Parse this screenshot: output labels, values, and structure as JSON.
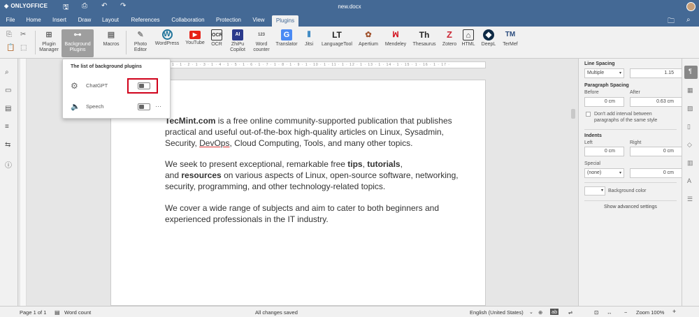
{
  "app": {
    "logo_text": "ONLYOFFICE",
    "doc_name": "new.docx"
  },
  "tabs": [
    "File",
    "Home",
    "Insert",
    "Draw",
    "Layout",
    "References",
    "Collaboration",
    "Protection",
    "View",
    "Plugins"
  ],
  "active_tab": "Plugins",
  "toolbar": {
    "plugin_manager": "Plugin Manager",
    "background_plugins": "Background Plugins",
    "macros": "Macros",
    "photo_editor": "Photo Editor",
    "wordpress": "WordPress",
    "youtube": "YouTube",
    "ocr": "OCR",
    "zhipu": "ZhiPu Copilot",
    "word_counter": "Word counter",
    "translator": "Translator",
    "jitsi": "Jitsi",
    "languagetool": "LanguageTool",
    "apertium": "Apertium",
    "mendeley": "Mendeley",
    "thesaurus": "Thesaurus",
    "zotero": "Zotero",
    "html": "HTML",
    "deepl": "DeepL",
    "termef": "TerMef"
  },
  "popup": {
    "title": "The list of background plugins",
    "items": [
      {
        "name": "ChatGPT",
        "enabled": false
      },
      {
        "name": "Speech",
        "enabled": false,
        "more": "···"
      }
    ]
  },
  "ruler_text": "· 1 · 1 · 2 · 1 · 3 · 1 · 4 · 1 · 5 · 1 · 6 · 1 · 7 · 1 · 8 · 1 · 9 · 1 · 10 · 1 · 11 · 1 · 12 · 1 · 13 · 1 · 14 · 1 · 15 · 1 · 16 · 1 · 17 ·",
  "document": {
    "p1": {
      "brand": "TecMint.com",
      "t1": " is a free online community-supported publication that publishes practical and useful out-of-the-box high-quality articles on Linux, Sysadmin, Security, ",
      "devops": "DevOps",
      "t2": ", Cloud Computing, Tools, and many other topics."
    },
    "p2": {
      "t1": "We seek to present exceptional, remarkable free ",
      "b1": "tips",
      "t2": ", ",
      "b2": "tutorials",
      "t3": ",",
      "t4": "and ",
      "b3": "resources",
      "t5": " on various aspects of Linux, open-source software, networking, security, programming, and other technology-related topics."
    },
    "p3": "We cover a wide range of subjects and aim to cater to both beginners and experienced professionals in the IT industry."
  },
  "right_panel": {
    "line_spacing": "Line Spacing",
    "line_spacing_mode": "Multiple",
    "line_spacing_value": "1.15",
    "paragraph_spacing": "Paragraph Spacing",
    "before_label": "Before",
    "after_label": "After",
    "before_value": "0 cm",
    "after_value": "0.63 cm",
    "dont_add": "Don't add interval between paragraphs of the same style",
    "indents": "Indents",
    "left_label": "Left",
    "right_label": "Right",
    "left_value": "0 cm",
    "right_value": "0 cm",
    "special_label": "Special",
    "special_mode": "(none)",
    "special_value": "0 cm",
    "background_color": "Background color",
    "show_advanced": "Show advanced settings"
  },
  "statusbar": {
    "page": "Page 1 of 1",
    "word_count": "Word count",
    "saved": "All changes saved",
    "language": "English (United States)",
    "zoom": "Zoom 100%",
    "minus": "−",
    "plus": "+"
  },
  "colors": {
    "header": "#446995",
    "highlight": "#d0021b",
    "toolbar": "#f1f1f1"
  }
}
